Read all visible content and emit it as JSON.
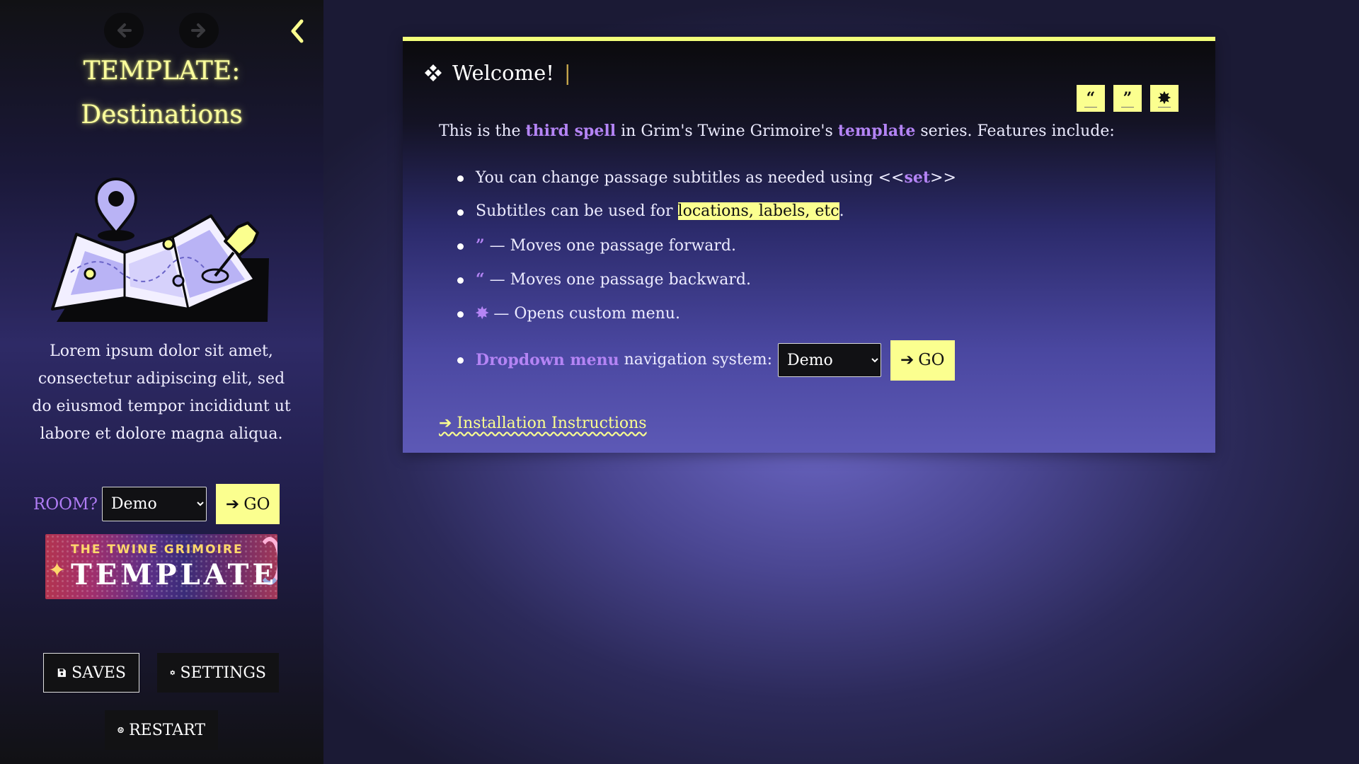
{
  "sidebar": {
    "title_line1": "TEMPLATE:",
    "title_line2": "Destinations",
    "caption": "Lorem ipsum dolor sit amet, consectetur adipiscing elit, sed do eiusmod tempor incididunt ut labore et dolore magna aliqua.",
    "room_label": "ROOM?",
    "room_select_value": "Demo",
    "go_label": "GO",
    "banner_small": "THE TWINE GRIMOIRE",
    "banner_big": "TEMPLATES",
    "saves_label": "SAVES",
    "settings_label": "SETTINGS",
    "restart_label": "RESTART"
  },
  "passage": {
    "title": "Welcome!",
    "cursor": "|",
    "intro_1": "This is the ",
    "intro_hl1": "third spell",
    "intro_2": " in Grim's Twine Grimoire's ",
    "intro_hl2": "template",
    "intro_3": " series. Features include:",
    "bullet1_a": "You can change passage subtitles as needed using <<",
    "bullet1_hl": "set",
    "bullet1_b": ">>",
    "bullet2_a": "Subtitles can be used for ",
    "bullet2_mark": "locations, labels, etc",
    "bullet2_b": ".",
    "bullet3_glyph": "”",
    "bullet3_text": " — Moves one passage forward.",
    "bullet4_glyph": "“",
    "bullet4_text": " — Moves one passage backward.",
    "bullet5_glyph": "✸",
    "bullet5_text": " — Opens custom menu.",
    "bullet6_hl": "Dropdown menu",
    "bullet6_text": " navigation system:",
    "dropdown_value": "Demo",
    "go_label": "GO",
    "install_link": "➔ Installation Instructions",
    "tool_back": "“",
    "tool_forward": "”",
    "tool_menu": "✸"
  },
  "colors": {
    "accent_yellow": "#fbff8f",
    "accent_purple": "#b484f5"
  }
}
